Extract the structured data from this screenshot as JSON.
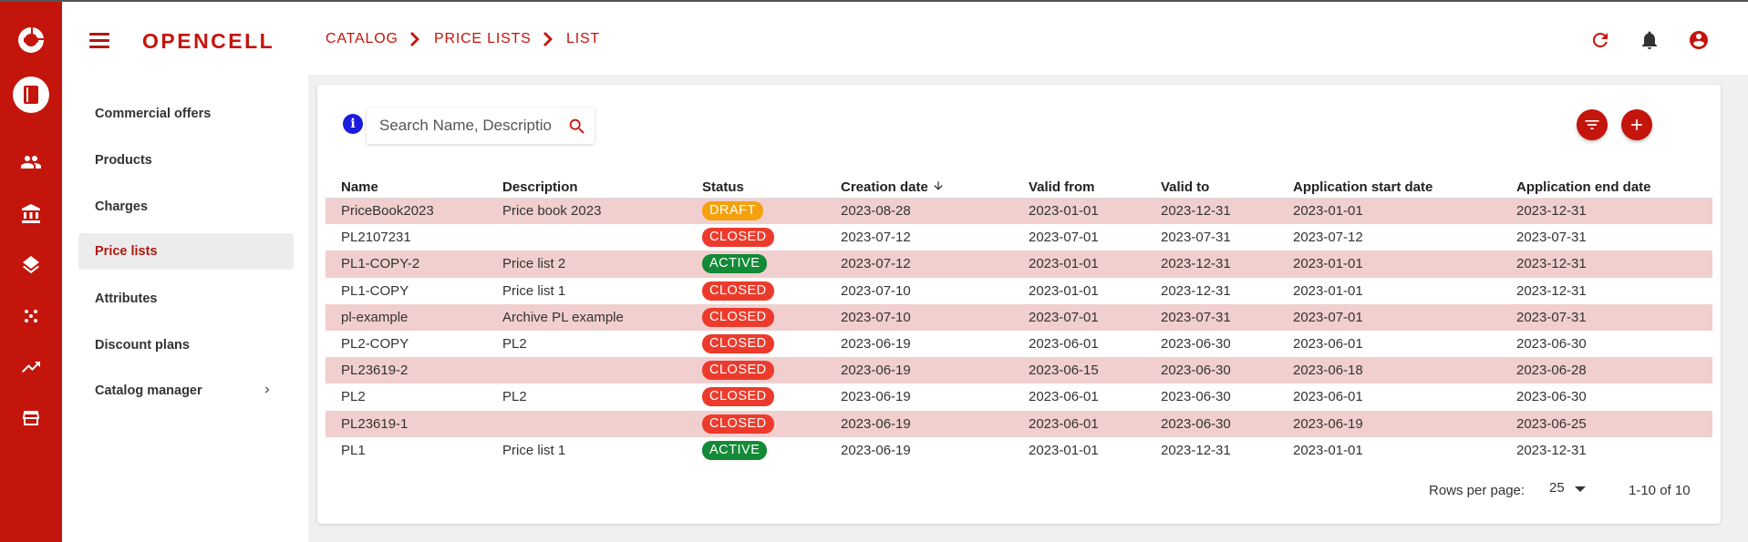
{
  "app": {
    "brand": "OPENCELL"
  },
  "colors": {
    "primary": "#c4150c",
    "row_shade": "#f1cfcf",
    "status_draft": "#f5a10e",
    "status_closed": "#ec3b2c",
    "status_active": "#138a36",
    "info": "#1b1bdc"
  },
  "rail": {
    "items": [
      {
        "icon": "book-icon",
        "active": true
      },
      {
        "icon": "people-icon"
      },
      {
        "icon": "bank-icon"
      },
      {
        "icon": "layers-icon"
      },
      {
        "icon": "dots-icon"
      },
      {
        "icon": "trending-up-icon"
      },
      {
        "icon": "store-icon"
      }
    ]
  },
  "sidebar": {
    "items": [
      {
        "label": "Commercial offers"
      },
      {
        "label": "Products"
      },
      {
        "label": "Charges"
      },
      {
        "label": "Price lists",
        "active": true
      },
      {
        "label": "Attributes"
      },
      {
        "label": "Discount plans"
      },
      {
        "label": "Catalog manager",
        "has_chevron": true
      }
    ]
  },
  "header": {
    "breadcrumb": [
      "CATALOG",
      "PRICE LISTS",
      "LIST"
    ],
    "icons": [
      "refresh-icon",
      "bell-icon",
      "account-icon"
    ]
  },
  "search": {
    "placeholder": "Search Name, Description"
  },
  "table": {
    "columns": [
      "Name",
      "Description",
      "Status",
      "Creation date",
      "Valid from",
      "Valid to",
      "Application start date",
      "Application end date"
    ],
    "sorted_column": "Creation date",
    "sort_direction": "descending",
    "rows": [
      {
        "name": "PriceBook2023",
        "description": "Price book 2023",
        "status": "DRAFT",
        "creation": "2023-08-28",
        "valid_from": "2023-01-01",
        "valid_to": "2023-12-31",
        "app_start": "2023-01-01",
        "app_end": "2023-12-31"
      },
      {
        "name": "PL2107231",
        "description": "",
        "status": "CLOSED",
        "creation": "2023-07-12",
        "valid_from": "2023-07-01",
        "valid_to": "2023-07-31",
        "app_start": "2023-07-12",
        "app_end": "2023-07-31"
      },
      {
        "name": "PL1-COPY-2",
        "description": "Price list 2",
        "status": "ACTIVE",
        "creation": "2023-07-12",
        "valid_from": "2023-01-01",
        "valid_to": "2023-12-31",
        "app_start": "2023-01-01",
        "app_end": "2023-12-31"
      },
      {
        "name": "PL1-COPY",
        "description": "Price list 1",
        "status": "CLOSED",
        "creation": "2023-07-10",
        "valid_from": "2023-01-01",
        "valid_to": "2023-12-31",
        "app_start": "2023-01-01",
        "app_end": "2023-12-31"
      },
      {
        "name": "pl-example",
        "description": "Archive PL example",
        "status": "CLOSED",
        "creation": "2023-07-10",
        "valid_from": "2023-07-01",
        "valid_to": "2023-07-31",
        "app_start": "2023-07-01",
        "app_end": "2023-07-31"
      },
      {
        "name": "PL2-COPY",
        "description": "PL2",
        "status": "CLOSED",
        "creation": "2023-06-19",
        "valid_from": "2023-06-01",
        "valid_to": "2023-06-30",
        "app_start": "2023-06-01",
        "app_end": "2023-06-30"
      },
      {
        "name": "PL23619-2",
        "description": "",
        "status": "CLOSED",
        "creation": "2023-06-19",
        "valid_from": "2023-06-15",
        "valid_to": "2023-06-30",
        "app_start": "2023-06-18",
        "app_end": "2023-06-28"
      },
      {
        "name": "PL2",
        "description": "PL2",
        "status": "CLOSED",
        "creation": "2023-06-19",
        "valid_from": "2023-06-01",
        "valid_to": "2023-06-30",
        "app_start": "2023-06-01",
        "app_end": "2023-06-30"
      },
      {
        "name": "PL23619-1",
        "description": "",
        "status": "CLOSED",
        "creation": "2023-06-19",
        "valid_from": "2023-06-01",
        "valid_to": "2023-06-30",
        "app_start": "2023-06-19",
        "app_end": "2023-06-25"
      },
      {
        "name": "PL1",
        "description": "Price list 1",
        "status": "ACTIVE",
        "creation": "2023-06-19",
        "valid_from": "2023-01-01",
        "valid_to": "2023-12-31",
        "app_start": "2023-01-01",
        "app_end": "2023-12-31"
      }
    ]
  },
  "pagination": {
    "rows_per_page_label": "Rows per page:",
    "rows_per_page_value": "25",
    "range_label": "1-10 of 10"
  }
}
